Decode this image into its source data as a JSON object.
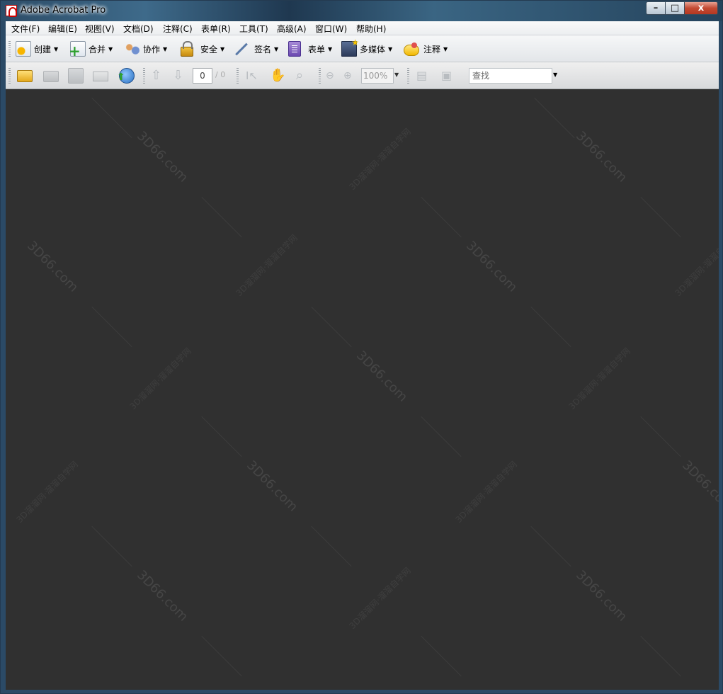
{
  "window": {
    "title": "Adobe Acrobat Pro",
    "controls": {
      "minimize": "–",
      "maximize": "□",
      "close": "x"
    }
  },
  "menubar": {
    "items": [
      {
        "label": "文件(F)"
      },
      {
        "label": "编辑(E)"
      },
      {
        "label": "视图(V)"
      },
      {
        "label": "文档(D)"
      },
      {
        "label": "注释(C)"
      },
      {
        "label": "表单(R)"
      },
      {
        "label": "工具(T)"
      },
      {
        "label": "高级(A)"
      },
      {
        "label": "窗口(W)"
      },
      {
        "label": "帮助(H)"
      }
    ]
  },
  "tasks_toolbar": {
    "buttons": [
      {
        "label": "创建",
        "icon": "create-pdf-icon"
      },
      {
        "label": "合并",
        "icon": "combine-files-icon"
      },
      {
        "label": "协作",
        "icon": "collaborate-icon"
      },
      {
        "label": "安全",
        "icon": "lock-icon"
      },
      {
        "label": "签名",
        "icon": "pen-icon"
      },
      {
        "label": "表单",
        "icon": "form-icon"
      },
      {
        "label": "多媒体",
        "icon": "film-star-icon"
      },
      {
        "label": "注释",
        "icon": "comment-icon"
      }
    ],
    "caret": "▼"
  },
  "file_toolbar": {
    "page_number": "0",
    "page_total": "/ 0",
    "zoom": "100%",
    "search_placeholder": "查找",
    "caret": "▼"
  },
  "watermarks": {
    "site": "3D66.com",
    "site_cn": "3D溜溜网·溜溜自学网"
  }
}
